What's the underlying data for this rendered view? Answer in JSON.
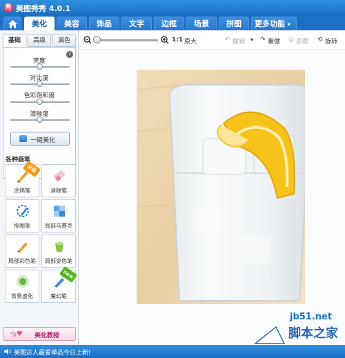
{
  "app": {
    "title": "美图秀秀 4.0.1",
    "logo_text": "秀"
  },
  "nav": {
    "home_icon": "home-icon",
    "tabs": [
      "美化",
      "美容",
      "饰品",
      "文字",
      "边框",
      "场景",
      "拼图"
    ],
    "more": "更多功能",
    "active": "美化"
  },
  "left": {
    "subtabs": [
      "基础",
      "高级",
      "调色"
    ],
    "sliders": [
      {
        "label": "亮度",
        "value": 0.5
      },
      {
        "label": "对比度",
        "value": 0.5
      },
      {
        "label": "色彩饱和度",
        "value": 0.5
      },
      {
        "label": "清晰度",
        "value": 0.5
      }
    ],
    "onekey_label": "一键美化",
    "brushes_heading": "各种画笔",
    "tools": [
      {
        "label": "涂鸦笔",
        "badge": "升级"
      },
      {
        "label": "消除笔",
        "badge": ""
      },
      {
        "label": "抠图笔",
        "badge": ""
      },
      {
        "label": "局部马赛克",
        "badge": ""
      },
      {
        "label": "局部彩色笔",
        "badge": ""
      },
      {
        "label": "局部变色笔",
        "badge": ""
      },
      {
        "label": "背景虚化",
        "badge": ""
      },
      {
        "label": "魔幻笔",
        "badge": "new"
      }
    ],
    "tutorial_label": "美化教程"
  },
  "toolbar": {
    "zoom_level": 0.0,
    "ratio": "1:1",
    "original_size": "原大",
    "undo": "撤销",
    "redo": "重做",
    "original_image": "原图",
    "rotate": "旋转"
  },
  "status": {
    "text": "美图达人最爱单品今日上新!"
  },
  "watermark": {
    "site": "jb51.net",
    "name": "脚本之家"
  },
  "colors": {
    "titlebar": "#1b6fc4",
    "accent": "#2a78cf",
    "badge_upgrade": "#f39a1e",
    "badge_new": "#53b81f"
  }
}
